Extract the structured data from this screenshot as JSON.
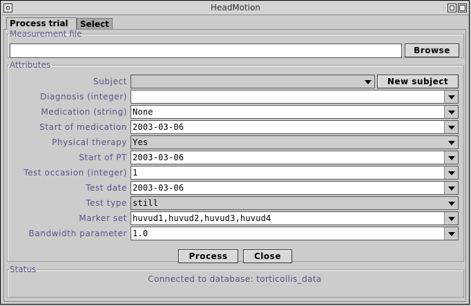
{
  "window": {
    "title": "HeadMotion"
  },
  "tabs": [
    {
      "label": "Process trial",
      "active": true
    },
    {
      "label": "Select",
      "active": false
    }
  ],
  "measurement": {
    "legend": "Measurement file",
    "value": "",
    "browse_label": "Browse"
  },
  "attributes": {
    "legend": "Attributes",
    "new_subject_label": "New subject",
    "fields": [
      {
        "label": "Subject",
        "value": ""
      },
      {
        "label": "Diagnosis (integer)",
        "value": ""
      },
      {
        "label": "Medication (string)",
        "value": "None"
      },
      {
        "label": "Start of medication",
        "value": "2003-03-06"
      },
      {
        "label": "Physical therapy",
        "value": "Yes"
      },
      {
        "label": "Start of PT",
        "value": "2003-03-06"
      },
      {
        "label": "Test occasion (integer)",
        "value": "1"
      },
      {
        "label": "Test date",
        "value": "2003-03-06"
      },
      {
        "label": "Test type",
        "value": "still"
      },
      {
        "label": "Marker set",
        "value": "huvud1,huvud2,huvud3,huvud4"
      },
      {
        "label": "Bandwidth parameter",
        "value": "1.0"
      }
    ]
  },
  "actions": {
    "process_label": "Process",
    "close_label": "Close"
  },
  "status": {
    "legend": "Status",
    "text": "Connected to database: torticollis_data"
  }
}
